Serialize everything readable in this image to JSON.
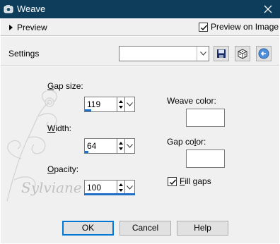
{
  "window": {
    "title": "Weave",
    "close_glyph": "✕"
  },
  "preview_bar": {
    "toggle_label": "Preview",
    "preview_on_image_label": "Preview on Image",
    "preview_on_image_checked": true
  },
  "settings": {
    "label": "Settings",
    "value": "",
    "icons": [
      "save-icon",
      "dice-icon",
      "reset-icon"
    ]
  },
  "controls": {
    "gap_size": {
      "label_access": "G",
      "label_rest": "ap size:",
      "value": "119",
      "fill_fraction": 0.2
    },
    "width": {
      "label_access": "W",
      "label_rest": "idth:",
      "value": "64",
      "fill_fraction": 0.1
    },
    "opacity": {
      "label_access": "O",
      "label_rest": "pacity:",
      "value": "100",
      "fill_fraction": 1.0
    },
    "weave_color": {
      "label": "Weave color:",
      "color": "#ffffff"
    },
    "gap_color": {
      "label_pre": "Gap co",
      "label_access": "l",
      "label_rest": "or:",
      "color": "#ffffff"
    },
    "fill_gaps": {
      "label_access": "F",
      "label_rest": "ill gaps",
      "checked": true
    }
  },
  "buttons": {
    "ok": "OK",
    "cancel": "Cancel",
    "help": "Help"
  },
  "watermark": {
    "text": "Sylviane"
  }
}
